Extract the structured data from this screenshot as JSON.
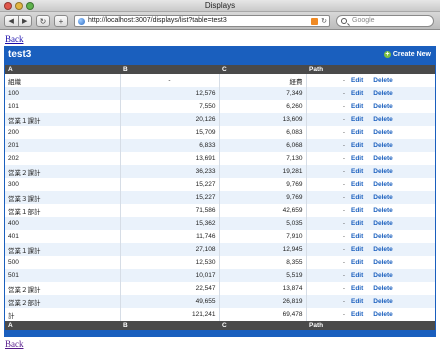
{
  "window": {
    "title": "Displays"
  },
  "toolbar": {
    "back_glyph": "◀",
    "forward_glyph": "▶",
    "reload_glyph": "↻",
    "add_glyph": "+",
    "url": "http://localhost:3007/displays/list?table=test3",
    "url_reload_glyph": "↻",
    "search_placeholder": "Google"
  },
  "page": {
    "back_label": "Back",
    "table_name": "test3",
    "create_new_label": "Create New",
    "create_new_glyph": "+",
    "columns": [
      "A",
      "B",
      "C",
      "Path",
      ""
    ],
    "edit_label": "Edit",
    "delete_label": "Delete",
    "rows": [
      {
        "a": "組織",
        "b": "-",
        "c": "経費",
        "path": "-"
      },
      {
        "a": "100",
        "b": "12,576",
        "c": "7,349",
        "path": "-"
      },
      {
        "a": "101",
        "b": "7,550",
        "c": "6,260",
        "path": "-"
      },
      {
        "a": "営業１課計",
        "b": "20,126",
        "c": "13,609",
        "path": "-"
      },
      {
        "a": "200",
        "b": "15,709",
        "c": "6,083",
        "path": "-"
      },
      {
        "a": "201",
        "b": "6,833",
        "c": "6,068",
        "path": "-"
      },
      {
        "a": "202",
        "b": "13,691",
        "c": "7,130",
        "path": "-"
      },
      {
        "a": "営業２課計",
        "b": "36,233",
        "c": "19,281",
        "path": "-"
      },
      {
        "a": "300",
        "b": "15,227",
        "c": "9,769",
        "path": "-"
      },
      {
        "a": "営業３課計",
        "b": "15,227",
        "c": "9,769",
        "path": "-"
      },
      {
        "a": "営業１部計",
        "b": "71,586",
        "c": "42,659",
        "path": "-"
      },
      {
        "a": "400",
        "b": "15,362",
        "c": "5,035",
        "path": "-"
      },
      {
        "a": "401",
        "b": "11,746",
        "c": "7,910",
        "path": "-"
      },
      {
        "a": "営業１課計",
        "b": "27,108",
        "c": "12,945",
        "path": "-"
      },
      {
        "a": "500",
        "b": "12,530",
        "c": "8,355",
        "path": "-"
      },
      {
        "a": "501",
        "b": "10,017",
        "c": "5,519",
        "path": "-"
      },
      {
        "a": "営業２課計",
        "b": "22,547",
        "c": "13,874",
        "path": "-"
      },
      {
        "a": "営業２部計",
        "b": "49,655",
        "c": "26,819",
        "path": "-"
      },
      {
        "a": "計",
        "b": "121,241",
        "c": "69,478",
        "path": "-"
      }
    ]
  },
  "colors": {
    "accent": "#1a5fbe",
    "header_row": "#4a4a4a",
    "alt_row": "#eaf2fb"
  }
}
